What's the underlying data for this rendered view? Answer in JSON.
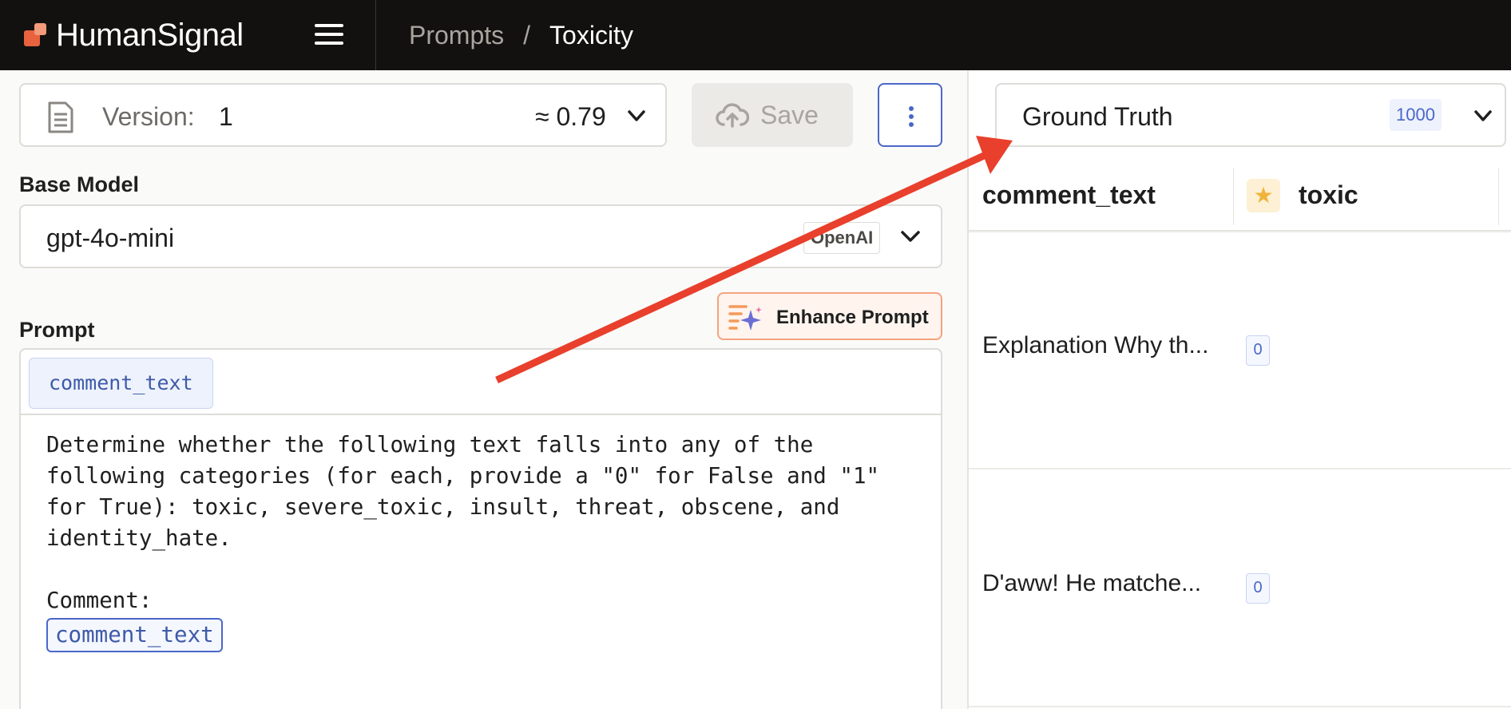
{
  "header": {
    "brand": "HumanSignal",
    "breadcrumb": [
      {
        "label": "Prompts"
      },
      {
        "label": "Toxicity"
      }
    ],
    "separator": "/"
  },
  "version": {
    "label": "Version:",
    "number": "1",
    "score": "≈ 0.79"
  },
  "actions": {
    "save_label": "Save"
  },
  "base_model": {
    "label": "Base Model",
    "model": "gpt-4o-mini",
    "provider": "OpenAI"
  },
  "prompt": {
    "label": "Prompt",
    "enhance_label": "Enhance Prompt",
    "variables": [
      "comment_text"
    ],
    "body": "Determine whether the following text falls into any of the\nfollowing categories (for each, provide a \"0\" for False and \"1\"\nfor True): toxic, severe_toxic, insult, threat, obscene, and\nidentity_hate.\n\nComment:\n",
    "inline_variable": "comment_text"
  },
  "ground_truth": {
    "label": "Ground Truth",
    "count": "1000"
  },
  "table": {
    "columns": [
      {
        "label": "comment_text"
      },
      {
        "label": "toxic",
        "icon": "star-icon"
      }
    ],
    "rows": [
      {
        "comment_text": "Explanation Why th...",
        "toxic": "0"
      },
      {
        "comment_text": "D'aww! He matche...",
        "toxic": "0"
      }
    ]
  },
  "colors": {
    "topbar": "#13110f",
    "accent": "#4a67c8",
    "brand_orange": "#e8623f",
    "annotation_arrow": "#e8402c"
  }
}
